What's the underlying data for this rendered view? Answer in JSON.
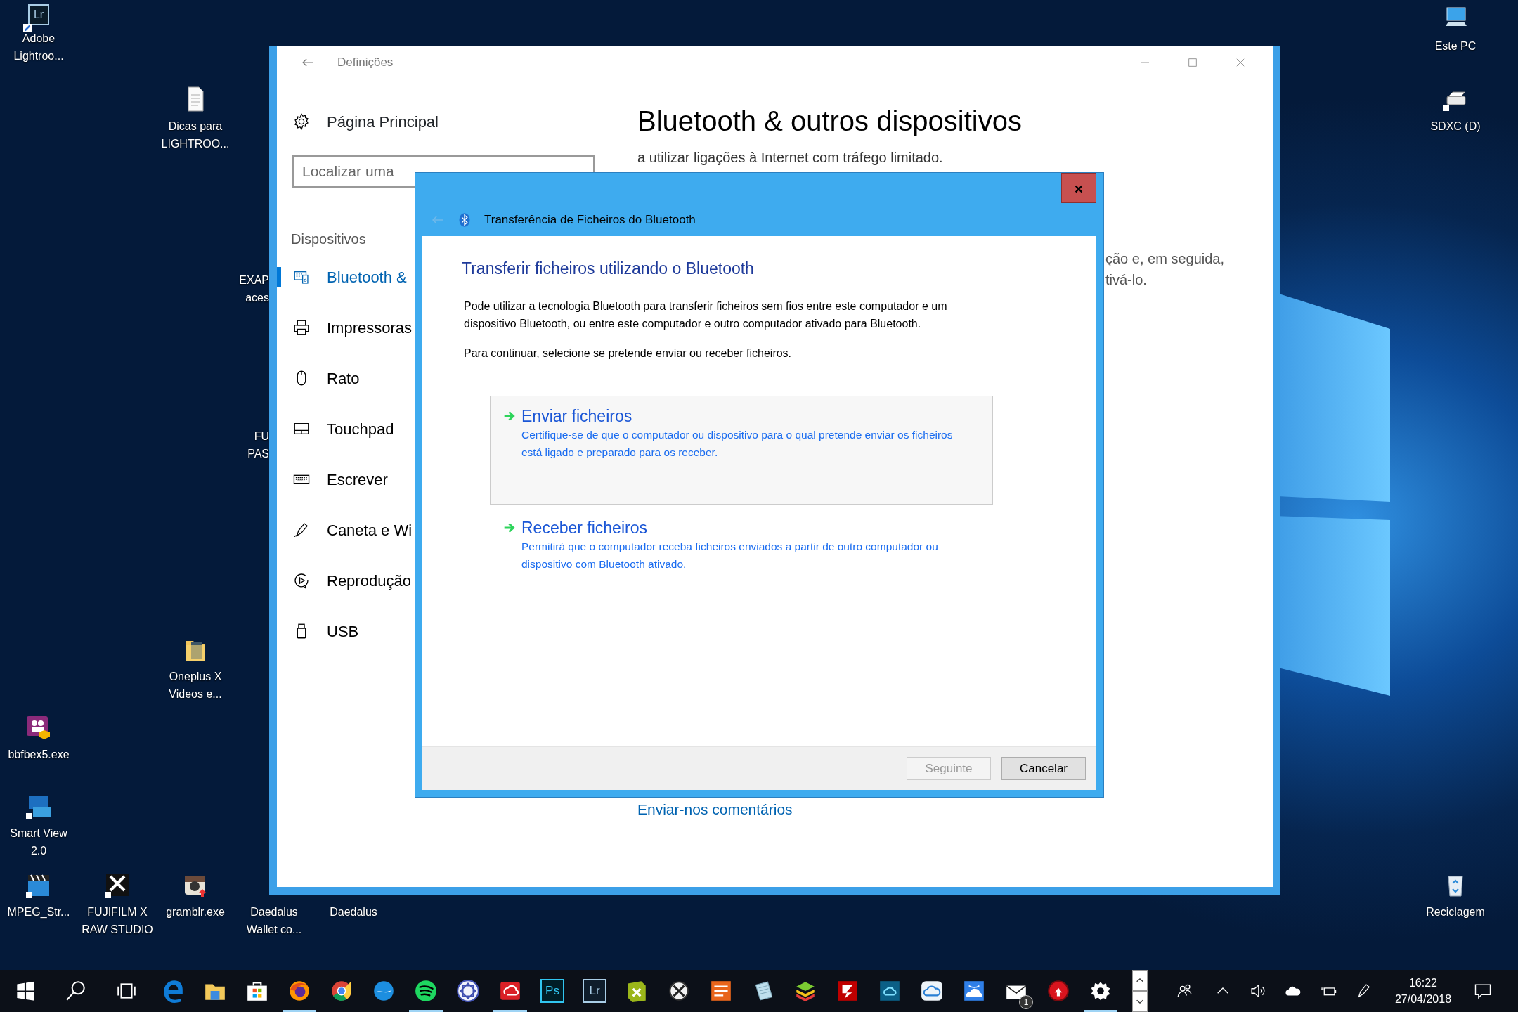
{
  "desktop_icons": [
    {
      "kind": "lightroom",
      "label": "Adobe Lightroo...",
      "glyph": "Lr"
    },
    {
      "kind": "document",
      "label": "Dicas para LIGHTROO..."
    },
    {
      "kind": "folder",
      "label": "Oneplus X Videos e..."
    },
    {
      "kind": "meeting",
      "label": "bbfbex5.exe"
    },
    {
      "kind": "smartview",
      "label": "Smart View 2.0"
    },
    {
      "kind": "clapper",
      "label": "MPEG_Str..."
    },
    {
      "kind": "raw",
      "label": "FUJIFILM X RAW STUDIO"
    },
    {
      "kind": "camera",
      "label": "gramblr.exe"
    },
    {
      "kind": "covered",
      "label": "Daedalus Wallet co..."
    },
    {
      "kind": "covered",
      "label": "Daedalus"
    },
    {
      "kind": "computer",
      "label": "Este PC"
    },
    {
      "kind": "drive",
      "label": "SDXC (D)"
    },
    {
      "kind": "recycle",
      "label": "Reciclagem"
    }
  ],
  "covered_labels": [
    {
      "lines": [
        "EXAP",
        "aces"
      ]
    },
    {
      "lines": [
        "FU",
        "PAS"
      ]
    }
  ],
  "settings_window": {
    "title": "Definições",
    "home": "Página Principal",
    "search": {
      "placeholder": "Localizar uma"
    },
    "section": "Dispositivos",
    "nav": [
      {
        "kind": "devices",
        "label": "Bluetooth &",
        "selected": true
      },
      {
        "kind": "printer",
        "label": "Impressoras",
        "selected": false
      },
      {
        "kind": "mouse",
        "label": "Rato",
        "selected": false
      },
      {
        "kind": "touchpad",
        "label": "Touchpad",
        "selected": false
      },
      {
        "kind": "keyboard",
        "label": "Escrever",
        "selected": false
      },
      {
        "kind": "pen",
        "label": "Caneta e Wi",
        "selected": false
      },
      {
        "kind": "play",
        "label": "Reprodução",
        "selected": false
      },
      {
        "kind": "usb",
        "label": "USB",
        "selected": false
      }
    ],
    "heading": "Bluetooth & outros dispositivos",
    "text": "a utilizar ligações à Internet com tráfego limitado.",
    "side_text": [
      "ção e, em seguida,",
      "tivá-lo."
    ],
    "feedback_link": "Enviar-nos comentários"
  },
  "dialog": {
    "title": "Transferência de Ficheiros do Bluetooth",
    "heading": "Transferir ficheiros utilizando o Bluetooth",
    "paragraphs": [
      "Pode utilizar a tecnologia Bluetooth para transferir ficheiros sem fios entre este computador e um dispositivo Bluetooth, ou entre este computador e outro computador ativado para Bluetooth.",
      "Para continuar, selecione se pretende enviar ou receber ficheiros."
    ],
    "options": [
      {
        "title": "Enviar ficheiros",
        "description": "Certifique-se de que o computador ou dispositivo para o qual pretende enviar os ficheiros está ligado e preparado para os receber.",
        "highlighted": true
      },
      {
        "title": "Receber ficheiros",
        "description": "Permitirá que o computador receba ficheiros enviados a partir de outro computador ou dispositivo com Bluetooth ativado.",
        "highlighted": false
      }
    ],
    "buttons": [
      {
        "label": "Seguinte",
        "disabled": true
      },
      {
        "label": "Cancelar",
        "disabled": false
      }
    ]
  },
  "taskbar": {
    "apps": [
      {
        "kind": "start",
        "running": false
      },
      {
        "kind": "search",
        "running": false
      },
      {
        "kind": "taskview",
        "running": false
      },
      {
        "kind": "edge",
        "running": false
      },
      {
        "kind": "explorer",
        "running": false
      },
      {
        "kind": "store",
        "running": false
      },
      {
        "kind": "firefox",
        "running": true
      },
      {
        "kind": "ring",
        "running": false
      },
      {
        "kind": "swoosh",
        "running": false
      },
      {
        "kind": "waves",
        "running": true
      },
      {
        "kind": "knot",
        "running": false
      },
      {
        "kind": "rings",
        "running": true
      },
      {
        "kind": "tile",
        "label": "Ps",
        "running": false
      },
      {
        "kind": "tile",
        "label": "Lr",
        "running": false
      },
      {
        "kind": "xcube",
        "running": false
      },
      {
        "kind": "xcircle",
        "running": false
      },
      {
        "kind": "doc",
        "running": false
      },
      {
        "kind": "notepad",
        "running": false
      },
      {
        "kind": "layers",
        "running": false
      },
      {
        "kind": "bolt",
        "running": false
      },
      {
        "kind": "cloudtile",
        "running": false
      },
      {
        "kind": "cloudwhite",
        "running": false
      },
      {
        "kind": "cloudsmile",
        "running": false
      },
      {
        "kind": "mail",
        "badge": "1",
        "running": false
      },
      {
        "kind": "arrowcircle",
        "running": false
      },
      {
        "kind": "gear",
        "running": true
      }
    ],
    "tray": [
      {
        "kind": "people"
      },
      {
        "kind": "chevron"
      },
      {
        "kind": "speaker"
      },
      {
        "kind": "cloud"
      },
      {
        "kind": "battery"
      },
      {
        "kind": "pen"
      }
    ],
    "clock": {
      "time": "16:22",
      "date": "27/04/2018"
    }
  }
}
